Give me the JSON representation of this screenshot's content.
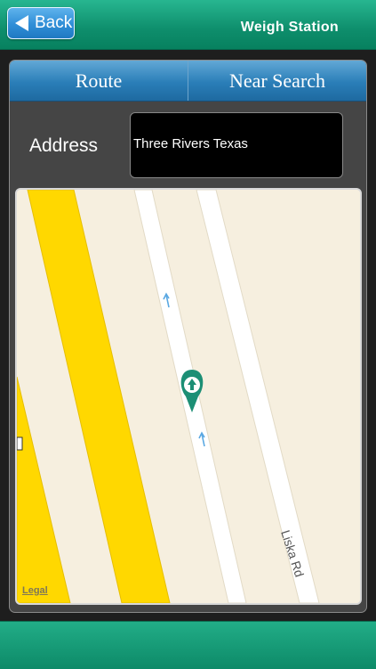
{
  "header": {
    "back_label": "Back",
    "title": "Weigh Station"
  },
  "tabs": [
    {
      "label": "Route"
    },
    {
      "label": "Near Search"
    }
  ],
  "address": {
    "label": "Address",
    "value": "Three Rivers Texas"
  },
  "map": {
    "road_label": "Liska Rd",
    "legal_label": "Legal",
    "marker_icon": "location-pin-arrow-icon"
  },
  "colors": {
    "header_green": "#0e8e6c",
    "tab_blue": "#2a7eb8",
    "highway_yellow": "#ffd800",
    "marker_teal": "#1c8f75"
  }
}
